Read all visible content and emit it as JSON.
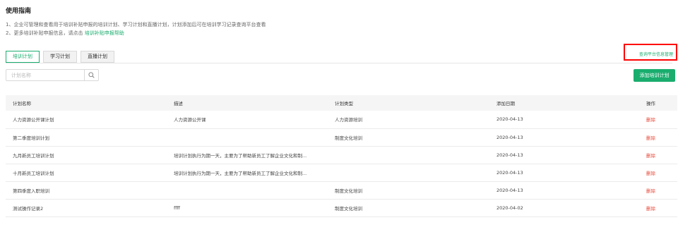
{
  "guide": {
    "title": "使用指南",
    "line1": "1、企业可管理和查看用于培训补贴申报的培训计划、学习计划和直播计划，计划添加后可在培训学习记录查询平台查看",
    "line2_prefix": "2、更多培训补贴申报信息，请点击",
    "line2_link": "培训补贴申报帮助"
  },
  "tabs": [
    {
      "label": "培训计划",
      "active": true
    },
    {
      "label": "学习计划",
      "active": false
    },
    {
      "label": "直播计划",
      "active": false
    }
  ],
  "platform_link": "查询平台信息管理",
  "search": {
    "placeholder": "计划名称",
    "icon": "search-icon"
  },
  "add_button": "添加培训计划",
  "table": {
    "headers": [
      "计划名称",
      "描述",
      "计划类型",
      "添加日期",
      "操作"
    ],
    "rows": [
      {
        "name": "人力资源公开课计划",
        "desc": "人力资源公开课",
        "type": "人力资源培训",
        "date": "2020-04-13",
        "action": "删除"
      },
      {
        "name": "第二季度培训计划",
        "desc": "",
        "type": "制度文化培训",
        "date": "2020-04-13",
        "action": "删除"
      },
      {
        "name": "九月新员工培训计划",
        "desc": "培训计划执行为期一天，主要为了帮助新员工了解企业文化和制...",
        "type": "",
        "date": "2020-04-13",
        "action": "删除"
      },
      {
        "name": "十月新员工培训计划",
        "desc": "培训计划执行为期一天，主要为了帮助新员工了解企业文化和制...",
        "type": "",
        "date": "2020-04-13",
        "action": "删除"
      },
      {
        "name": "第四季度入职培训",
        "desc": "",
        "type": "制度文化培训",
        "date": "2020-04-13",
        "action": "删除"
      },
      {
        "name": "测试操作记录2",
        "desc": "ffff",
        "type": "制度文化培训",
        "date": "2020-04-02",
        "action": "删除"
      }
    ]
  },
  "colors": {
    "accent": "#1aad6e",
    "delete": "#e8493a",
    "highlight": "#ff0000"
  }
}
